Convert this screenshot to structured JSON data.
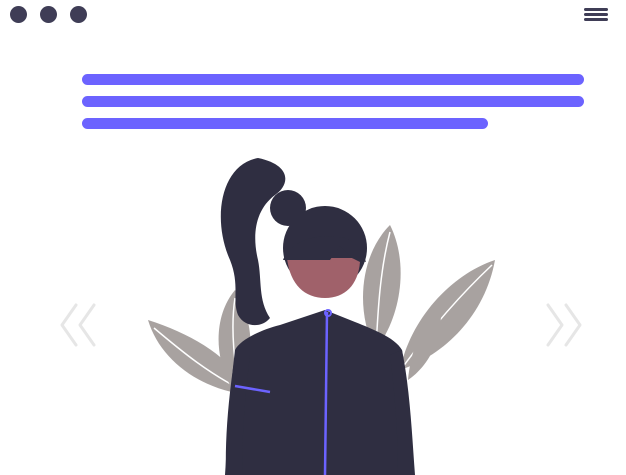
{
  "window": {
    "controls": [
      "dot",
      "dot",
      "dot"
    ],
    "menu_icon": "hamburger-menu-icon"
  },
  "text_placeholder": {
    "line_count": 3,
    "color": "#6c63ff"
  },
  "carousel": {
    "prev_icon": "chevron-double-left-icon",
    "next_icon": "chevron-double-right-icon"
  },
  "illustration": {
    "subject": "woman-with-ponytail-and-leaves",
    "colors": {
      "hair": "#2f2e41",
      "skin": "#a0616a",
      "jacket": "#2f2e41",
      "zipper": "#6c63ff",
      "leaves": "#a8a2a0",
      "arrows": "#e6e6e6"
    }
  }
}
